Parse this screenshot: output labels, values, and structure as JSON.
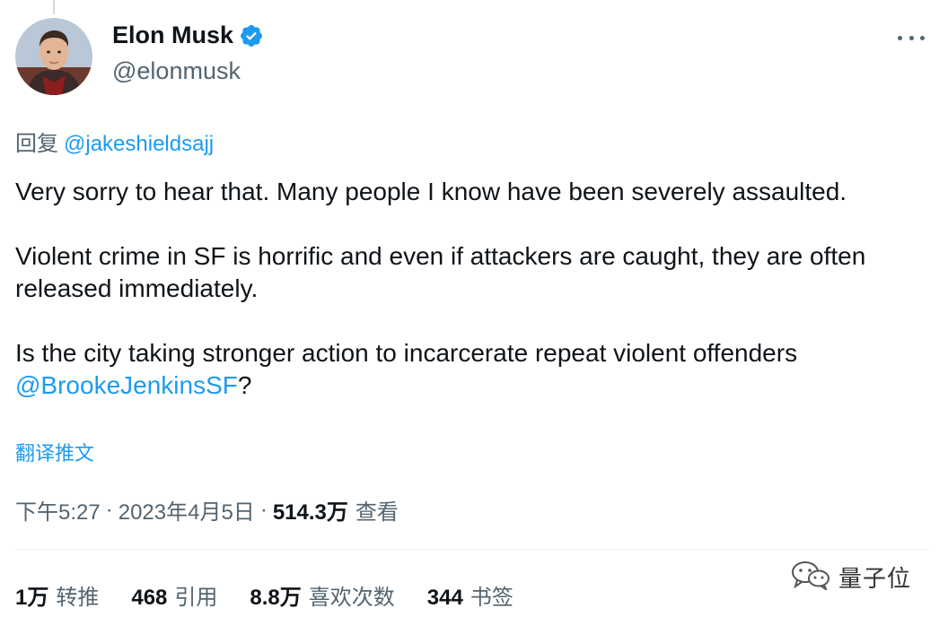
{
  "author": {
    "display_name": "Elon Musk",
    "handle": "@elonmusk"
  },
  "reply": {
    "prefix": "回复",
    "mention": "@jakeshieldsajj"
  },
  "tweet": {
    "para1": "Very sorry to hear that. Many people I know have been severely assaulted.",
    "para2": "Violent crime in SF is horrific and even if attackers are caught, they are often released immediately.",
    "para3_text": "Is the city taking stronger action to incarcerate repeat violent offenders ",
    "para3_mention": "@BrookeJenkinsSF",
    "para3_end": "?"
  },
  "translate_label": "翻译推文",
  "meta": {
    "time": "下午5:27",
    "date": "2023年4月5日",
    "views_count": "514.3万",
    "views_label": "查看",
    "separator": "·"
  },
  "stats": {
    "retweets": {
      "count": "1万",
      "label": "转推"
    },
    "quotes": {
      "count": "468",
      "label": "引用"
    },
    "likes": {
      "count": "8.8万",
      "label": "喜欢次数"
    },
    "bookmarks": {
      "count": "344",
      "label": "书签"
    }
  },
  "watermark": {
    "text": "量子位",
    "icon": "wechat-icon"
  },
  "colors": {
    "accent": "#1d9bf0",
    "secondary_text": "#536471",
    "primary_text": "#0f1419"
  }
}
